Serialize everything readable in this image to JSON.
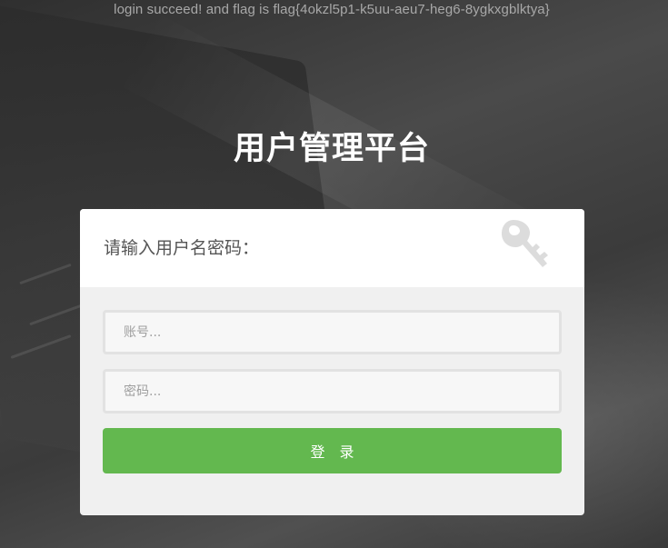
{
  "flag_message": "login succeed! and flag is flag{4okzl5p1-k5uu-aeu7-heg6-8ygkxgblktya}",
  "page_title": "用户管理平台",
  "login_card": {
    "subtitle": "请输入用户名密码：",
    "header_icon": "key-icon",
    "username_field": {
      "placeholder": "账号...",
      "value": ""
    },
    "password_field": {
      "placeholder": "密码...",
      "value": ""
    },
    "login_button_label": "登录"
  },
  "colors": {
    "accent_green": "#63b84f",
    "card_header_bg": "#ffffff",
    "card_body_bg": "#f0f0f0",
    "title_text": "#ffffff",
    "flag_text": "#a8a8a8"
  }
}
